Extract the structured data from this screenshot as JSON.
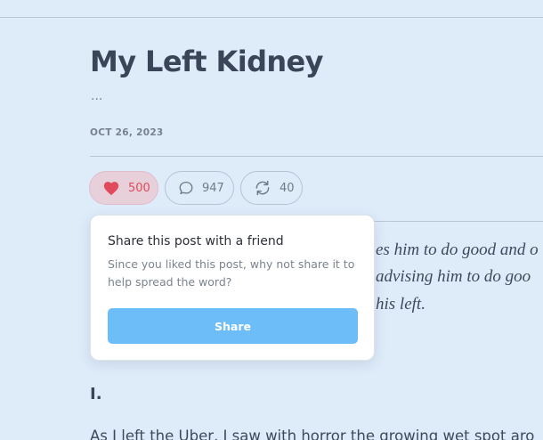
{
  "post": {
    "title": "My Left Kidney",
    "subtitle": "...",
    "date": "OCT 26, 2023"
  },
  "actions": {
    "like_count": "500",
    "comment_count": "947",
    "restack_count": "40",
    "liked": true
  },
  "content": {
    "visible_lines": [
      "es him to do good and o",
      " advising him to do goo",
      "his left."
    ],
    "section_heading": "I.",
    "paragraph_start": "As I left the Uber, I saw with horror the growing wet spot aro"
  },
  "share_popover": {
    "title": "Share this post with a friend",
    "description": "Since you liked this post, why not share it to help spread the word?",
    "button_label": "Share"
  },
  "colors": {
    "background": "#deebf9",
    "like_accent": "#e04a5a",
    "share_button": "#6dbdf9"
  },
  "icons": {
    "like": "heart-icon",
    "comment": "comment-icon",
    "restack": "restack-icon"
  }
}
